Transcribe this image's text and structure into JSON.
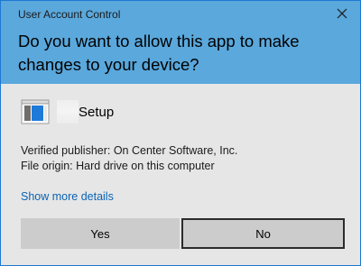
{
  "window": {
    "title": "User Account Control"
  },
  "prompt": {
    "question": "Do you want to allow this app to make changes to your device?"
  },
  "app": {
    "name": "Setup",
    "icon": "window-app-icon"
  },
  "details": {
    "publisher": "Verified publisher: On Center Software, Inc.",
    "origin": "File origin: Hard drive on this computer",
    "show_more": "Show more details"
  },
  "buttons": {
    "yes": "Yes",
    "no": "No"
  },
  "colors": {
    "header_bg": "#5aa8dc",
    "body_bg": "#e6e6e6",
    "link": "#0a63b4",
    "button_bg": "#cccccc"
  }
}
